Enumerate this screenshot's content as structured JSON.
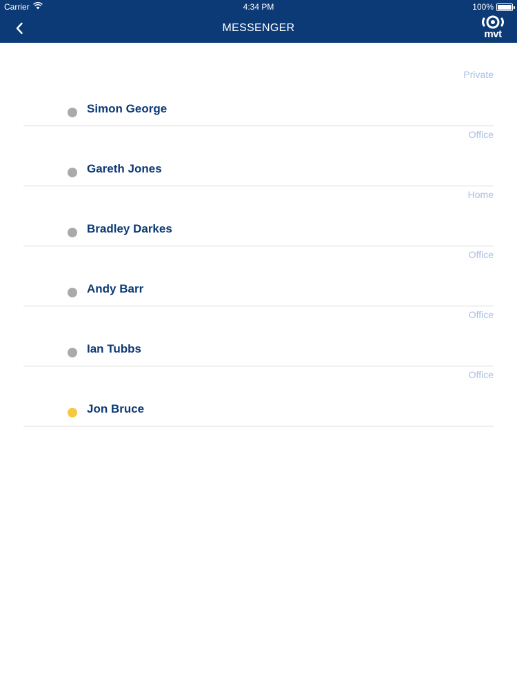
{
  "status_bar": {
    "carrier": "Carrier",
    "time": "4:34 PM",
    "battery": "100%"
  },
  "nav": {
    "title": "MESSENGER",
    "logo_text": "mvt"
  },
  "contacts": [
    {
      "name": "Simon George",
      "type": "Private",
      "status_color": "#aaaaaa"
    },
    {
      "name": "Gareth Jones",
      "type": "Office",
      "status_color": "#aaaaaa"
    },
    {
      "name": "Bradley Darkes",
      "type": "Home",
      "status_color": "#aaaaaa"
    },
    {
      "name": "Andy Barr",
      "type": "Office",
      "status_color": "#aaaaaa"
    },
    {
      "name": "Ian Tubbs",
      "type": "Office",
      "status_color": "#aaaaaa"
    },
    {
      "name": "Jon Bruce",
      "type": "Office",
      "status_color": "#f5c842"
    }
  ],
  "colors": {
    "header_bg": "#0c3a76",
    "name_text": "#0c3a76",
    "type_text": "#a7bee3",
    "divider": "#d9d9d9"
  },
  "icons": {
    "back": "chevron-left-icon",
    "wifi": "wifi-icon",
    "battery": "battery-icon",
    "logo": "mvt-logo-icon"
  }
}
